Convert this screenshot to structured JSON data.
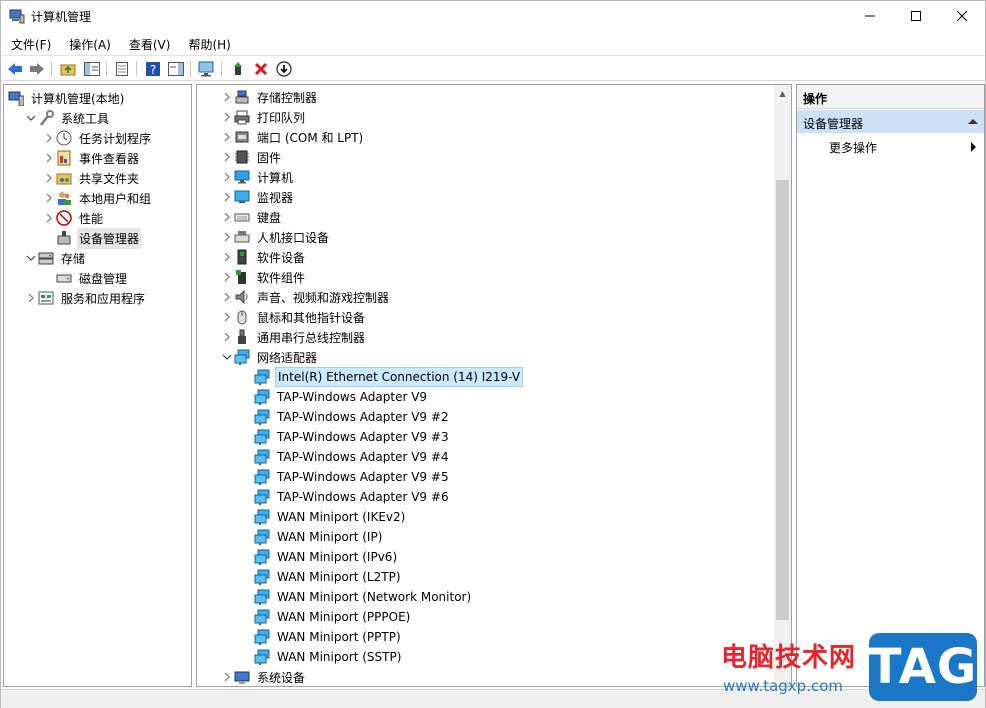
{
  "window": {
    "title": "计算机管理"
  },
  "menu": [
    "文件(F)",
    "操作(A)",
    "查看(V)",
    "帮助(H)"
  ],
  "left_tree": [
    {
      "label": "计算机管理(本地)",
      "level": 0,
      "expand": "",
      "icon": "computer-management-icon"
    },
    {
      "label": "系统工具",
      "level": 1,
      "expand": "down",
      "icon": "tools-icon"
    },
    {
      "label": "任务计划程序",
      "level": 2,
      "expand": "right",
      "icon": "clock-icon"
    },
    {
      "label": "事件查看器",
      "level": 2,
      "expand": "right",
      "icon": "event-viewer-icon"
    },
    {
      "label": "共享文件夹",
      "level": 2,
      "expand": "right",
      "icon": "shared-folder-icon"
    },
    {
      "label": "本地用户和组",
      "level": 2,
      "expand": "right",
      "icon": "users-icon"
    },
    {
      "label": "性能",
      "level": 2,
      "expand": "right",
      "icon": "performance-icon"
    },
    {
      "label": "设备管理器",
      "level": 2,
      "expand": "",
      "icon": "device-manager-icon",
      "selected": true
    },
    {
      "label": "存储",
      "level": 1,
      "expand": "down",
      "icon": "storage-icon"
    },
    {
      "label": "磁盘管理",
      "level": 2,
      "expand": "",
      "icon": "disk-icon"
    },
    {
      "label": "服务和应用程序",
      "level": 1,
      "expand": "right",
      "icon": "services-icon"
    }
  ],
  "device_tree": [
    {
      "label": "存储控制器",
      "level": 0,
      "expand": "right",
      "icon": "storage-controller-icon"
    },
    {
      "label": "打印队列",
      "level": 0,
      "expand": "right",
      "icon": "printer-icon"
    },
    {
      "label": "端口 (COM 和 LPT)",
      "level": 0,
      "expand": "right",
      "icon": "port-icon"
    },
    {
      "label": "固件",
      "level": 0,
      "expand": "right",
      "icon": "firmware-icon"
    },
    {
      "label": "计算机",
      "level": 0,
      "expand": "right",
      "icon": "computer-icon"
    },
    {
      "label": "监视器",
      "level": 0,
      "expand": "right",
      "icon": "monitor-icon"
    },
    {
      "label": "键盘",
      "level": 0,
      "expand": "right",
      "icon": "keyboard-icon"
    },
    {
      "label": "人机接口设备",
      "level": 0,
      "expand": "right",
      "icon": "hid-icon"
    },
    {
      "label": "软件设备",
      "level": 0,
      "expand": "right",
      "icon": "software-device-icon"
    },
    {
      "label": "软件组件",
      "level": 0,
      "expand": "right",
      "icon": "software-component-icon"
    },
    {
      "label": "声音、视频和游戏控制器",
      "level": 0,
      "expand": "right",
      "icon": "sound-icon"
    },
    {
      "label": "鼠标和其他指针设备",
      "level": 0,
      "expand": "right",
      "icon": "mouse-icon"
    },
    {
      "label": "通用串行总线控制器",
      "level": 0,
      "expand": "right",
      "icon": "usb-icon"
    },
    {
      "label": "网络适配器",
      "level": 0,
      "expand": "down",
      "icon": "network-adapter-icon"
    },
    {
      "label": "Intel(R) Ethernet Connection (14) I219-V",
      "level": 1,
      "expand": "",
      "icon": "network-adapter-icon",
      "selected": true
    },
    {
      "label": "TAP-Windows Adapter V9",
      "level": 1,
      "expand": "",
      "icon": "network-adapter-icon"
    },
    {
      "label": "TAP-Windows Adapter V9 #2",
      "level": 1,
      "expand": "",
      "icon": "network-adapter-icon"
    },
    {
      "label": "TAP-Windows Adapter V9 #3",
      "level": 1,
      "expand": "",
      "icon": "network-adapter-icon"
    },
    {
      "label": "TAP-Windows Adapter V9 #4",
      "level": 1,
      "expand": "",
      "icon": "network-adapter-icon"
    },
    {
      "label": "TAP-Windows Adapter V9 #5",
      "level": 1,
      "expand": "",
      "icon": "network-adapter-icon"
    },
    {
      "label": "TAP-Windows Adapter V9 #6",
      "level": 1,
      "expand": "",
      "icon": "network-adapter-icon"
    },
    {
      "label": "WAN Miniport (IKEv2)",
      "level": 1,
      "expand": "",
      "icon": "network-adapter-icon"
    },
    {
      "label": "WAN Miniport (IP)",
      "level": 1,
      "expand": "",
      "icon": "network-adapter-icon"
    },
    {
      "label": "WAN Miniport (IPv6)",
      "level": 1,
      "expand": "",
      "icon": "network-adapter-icon"
    },
    {
      "label": "WAN Miniport (L2TP)",
      "level": 1,
      "expand": "",
      "icon": "network-adapter-icon"
    },
    {
      "label": "WAN Miniport (Network Monitor)",
      "level": 1,
      "expand": "",
      "icon": "network-adapter-icon"
    },
    {
      "label": "WAN Miniport (PPPOE)",
      "level": 1,
      "expand": "",
      "icon": "network-adapter-icon"
    },
    {
      "label": "WAN Miniport (PPTP)",
      "level": 1,
      "expand": "",
      "icon": "network-adapter-icon"
    },
    {
      "label": "WAN Miniport (SSTP)",
      "level": 1,
      "expand": "",
      "icon": "network-adapter-icon"
    },
    {
      "label": "系统设备",
      "level": 0,
      "expand": "right",
      "icon": "system-device-icon"
    }
  ],
  "actions": {
    "header": "操作",
    "section": "设备管理器",
    "more": "更多操作"
  },
  "watermark": {
    "site_name": "电脑技术网",
    "url": "www.tagxp.com",
    "logo": "TAG"
  }
}
